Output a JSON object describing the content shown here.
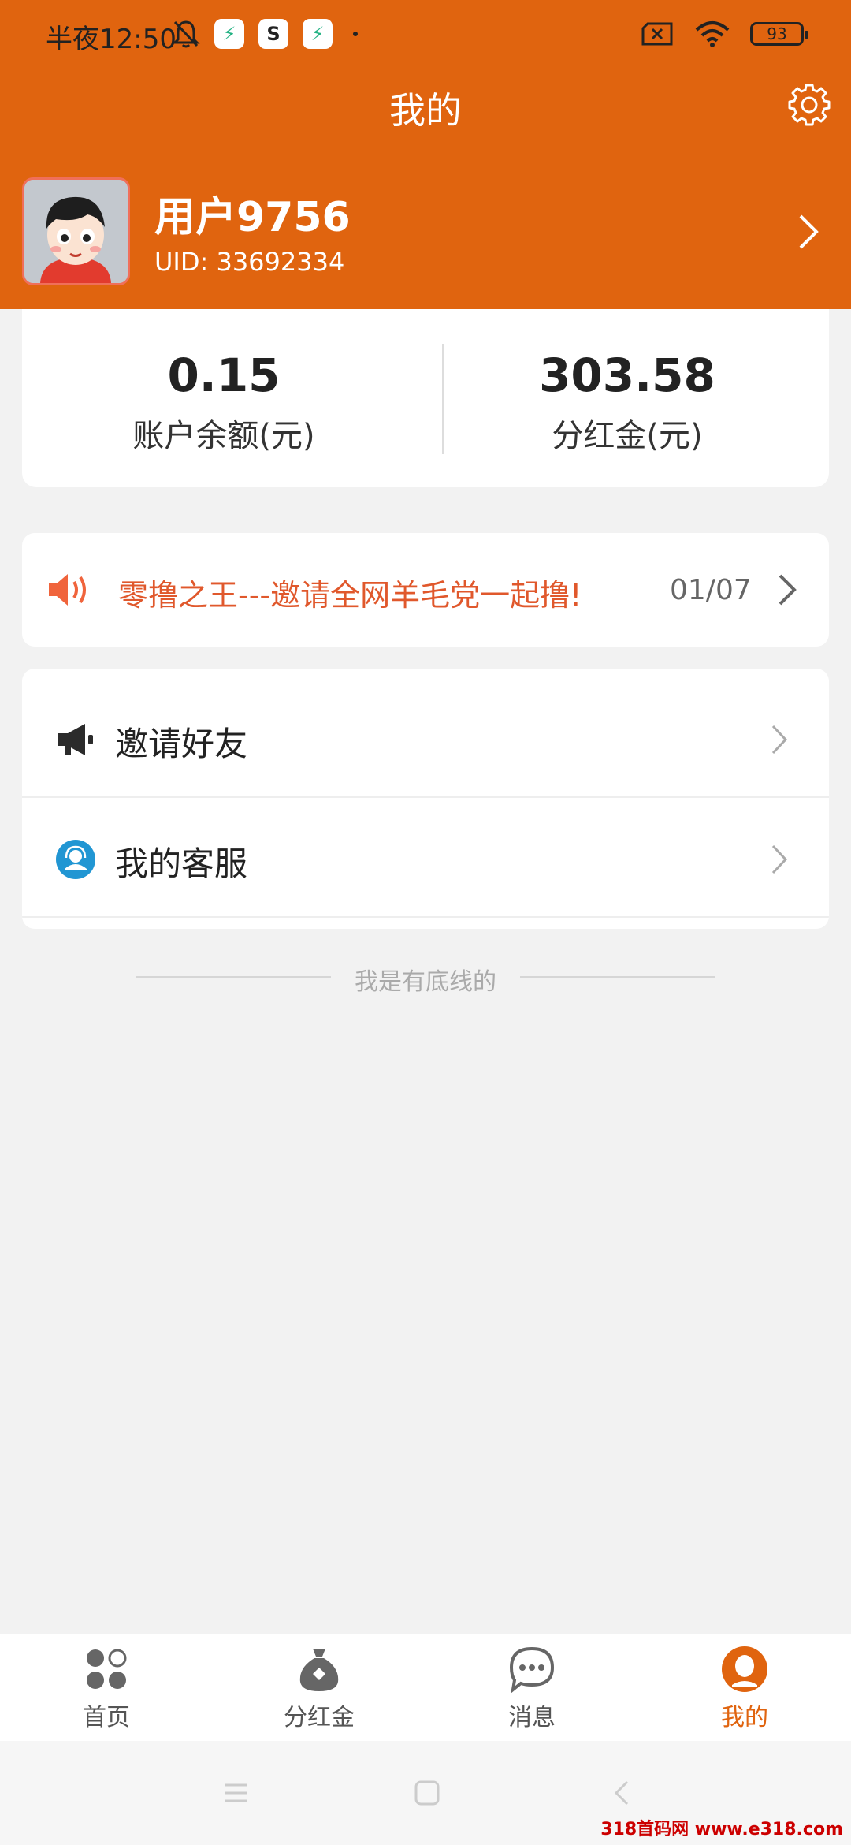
{
  "status_bar": {
    "time": "半夜12:50",
    "battery": "93",
    "app_icon_s": "S"
  },
  "header": {
    "title": "我的"
  },
  "profile": {
    "username": "用户9756",
    "uid": "UID: 33692334"
  },
  "balance": {
    "account_value": "0.15",
    "account_label": "账户余额(元)",
    "dividend_value": "303.58",
    "dividend_label": "分红金(元)"
  },
  "notice": {
    "text": "零撸之王---邀请全网羊毛党一起撸!",
    "page": "01/07"
  },
  "menu": {
    "items": [
      {
        "label": "邀请好友",
        "icon": "megaphone-icon"
      },
      {
        "label": "我的客服",
        "icon": "customer-service-icon"
      }
    ]
  },
  "footer": {
    "bottom_text": "我是有底线的"
  },
  "bottom_nav": {
    "items": [
      {
        "label": "首页",
        "icon": "home-grid-icon",
        "active": false
      },
      {
        "label": "分红金",
        "icon": "money-bag-icon",
        "active": false
      },
      {
        "label": "消息",
        "icon": "chat-bubble-icon",
        "active": false
      },
      {
        "label": "我的",
        "icon": "user-icon",
        "active": true
      }
    ]
  },
  "watermark": "318首码网 www.e318.com",
  "colors": {
    "brand": "#e0640f",
    "notice_text": "#e0582c",
    "background": "#f2f2f2"
  }
}
